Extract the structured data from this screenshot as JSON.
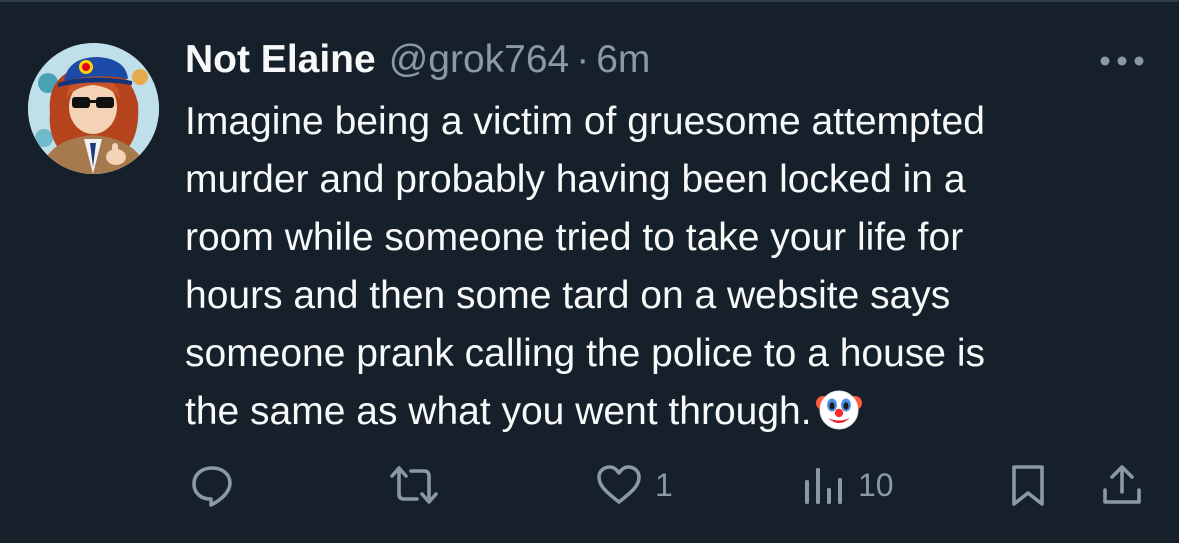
{
  "author": {
    "display_name": "Not Elaine",
    "handle": "@grok764",
    "separator": "·",
    "time": "6m",
    "avatar_icon": "anime-character-avatar-icon"
  },
  "tweet": {
    "text": "Imagine being a victim of gruesome attempted\nmurder and probably having been locked in a\nroom while someone tried to take your life for\nhours and then some tard on a website says\nsomeone prank calling the police to a house is\nthe same as what you went through.",
    "emoji": "clown-face-emoji"
  },
  "actions": {
    "reply": {
      "icon": "reply-icon",
      "count": ""
    },
    "retweet": {
      "icon": "retweet-icon",
      "count": ""
    },
    "like": {
      "icon": "heart-icon",
      "count": "1"
    },
    "views": {
      "icon": "views-bar-chart-icon",
      "count": "10"
    },
    "bookmark": {
      "icon": "bookmark-icon"
    },
    "share": {
      "icon": "share-icon"
    }
  },
  "colors": {
    "background": "#15202b",
    "text": "#f7f9f9",
    "secondary": "#8b98a5"
  }
}
